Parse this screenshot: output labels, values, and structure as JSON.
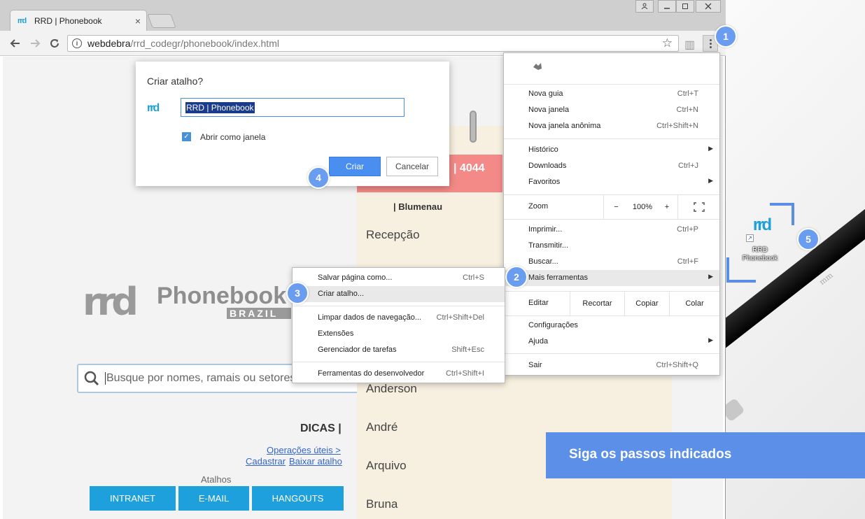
{
  "window": {
    "tab_title": "RRD | Phonebook",
    "tab_favicon": "rrd",
    "tab_close": "×",
    "url_host": "webdebra",
    "url_path": "/rrd_codegr/phonebook/index.html"
  },
  "page": {
    "logo_mark": "rrd",
    "logo_name": "Phonebook",
    "logo_sub": "BRAZIL",
    "search_placeholder": "Busque por nomes, ramais ou setores",
    "dicas_title": "DICAS |",
    "link_operacoes": "Operações úteis >",
    "link_cadastrar": "Cadastrar",
    "link_baixar": "Baixar atalho",
    "atalhos_label": "Atalhos",
    "buttons": [
      "INTRANET",
      "E-MAIL",
      "HANGOUTS"
    ],
    "card_number": "| 4044",
    "card_city": "| Blumenau",
    "card_entries": [
      "Recepção",
      "Anderson",
      "André",
      "Arquivo",
      "Bruna"
    ]
  },
  "dialog": {
    "title": "Criar atalho?",
    "icon_text": "rrd",
    "input_value": "RRD | Phonebook",
    "checkbox_label": "Abrir como janela",
    "check_mark": "✓",
    "create_label": "Criar",
    "cancel_label": "Cancelar"
  },
  "chrome_menu": {
    "items": [
      {
        "label": "Nova guia",
        "shortcut": "Ctrl+T"
      },
      {
        "label": "Nova janela",
        "shortcut": "Ctrl+N"
      },
      {
        "label": "Nova janela anônima",
        "shortcut": "Ctrl+Shift+N"
      },
      {
        "label": "Histórico",
        "shortcut": ""
      },
      {
        "label": "Downloads",
        "shortcut": "Ctrl+J"
      },
      {
        "label": "Favoritos",
        "shortcut": ""
      },
      {
        "label": "Imprimir...",
        "shortcut": "Ctrl+P"
      },
      {
        "label": "Transmitir...",
        "shortcut": ""
      },
      {
        "label": "Buscar...",
        "shortcut": "Ctrl+F"
      },
      {
        "label": "Mais ferramentas",
        "shortcut": ""
      },
      {
        "label": "Configurações",
        "shortcut": ""
      },
      {
        "label": "Ajuda",
        "shortcut": ""
      },
      {
        "label": "Sair",
        "shortcut": "Ctrl+Shift+Q"
      }
    ],
    "zoom_label": "Zoom",
    "zoom_minus": "−",
    "zoom_value": "100%",
    "zoom_plus": "+",
    "edit_label": "Editar",
    "edit_cut": "Recortar",
    "edit_copy": "Copiar",
    "edit_paste": "Colar"
  },
  "submenu": {
    "items": [
      {
        "label": "Salvar página como...",
        "shortcut": "Ctrl+S"
      },
      {
        "label": "Criar atalho...",
        "shortcut": ""
      },
      {
        "label": "Limpar dados de navegação...",
        "shortcut": "Ctrl+Shift+Del"
      },
      {
        "label": "Extensões",
        "shortcut": ""
      },
      {
        "label": "Gerenciador de tarefas",
        "shortcut": "Shift+Esc"
      },
      {
        "label": "Ferramentas do desenvolvedor",
        "shortcut": "Ctrl+Shift+I"
      }
    ]
  },
  "steps": [
    "1",
    "2",
    "3",
    "4",
    "5"
  ],
  "desktop_icon": {
    "mark": "rrd",
    "arrow": "↗",
    "label_line1": "RRD",
    "label_line2": "Phonebook"
  },
  "pencil_text": "mm",
  "banner_text": "Siga os passos indicados",
  "colors": {
    "accent": "#5c8fe8",
    "step": "#6a9cf0",
    "card_head": "#f48a87",
    "button_blue": "#1ea0dc"
  }
}
